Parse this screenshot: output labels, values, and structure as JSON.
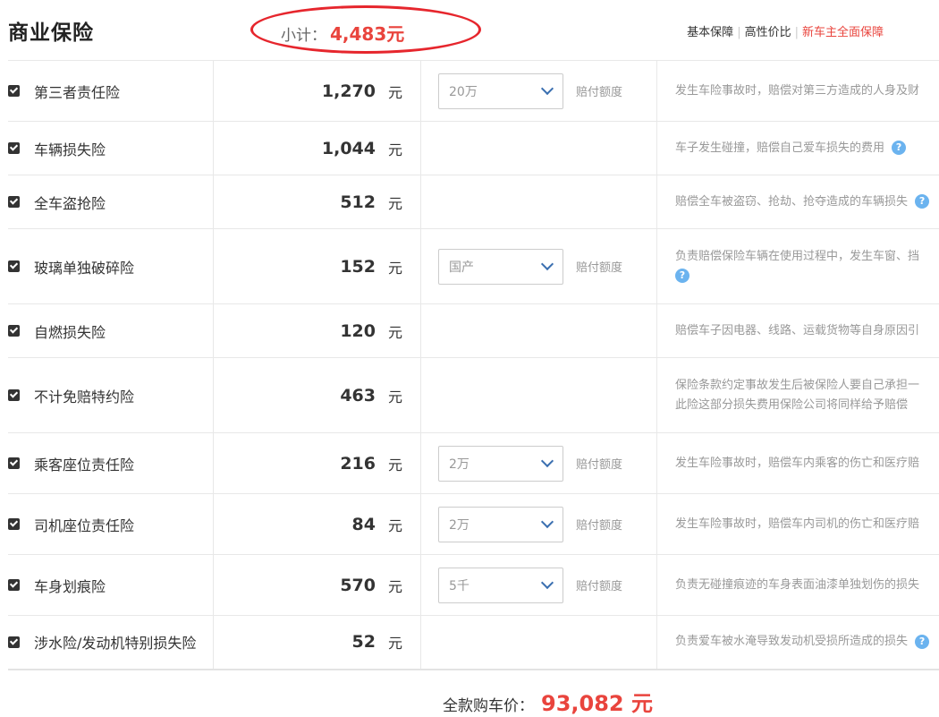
{
  "header": {
    "title": "商业保险",
    "subtotal_label": "小计：",
    "subtotal_value": "4,483元",
    "plans": [
      "基本保障",
      "高性价比",
      "新车主全面保障"
    ]
  },
  "unit": "元",
  "coverage_label": "赔付额度",
  "help_glyph": "?",
  "rows": [
    {
      "name": "第三者责任险",
      "price": "1,270",
      "select": "20万",
      "desc": "发生车险事故时，赔偿对第三方造成的人身及财",
      "desc2": ""
    },
    {
      "name": "车辆损失险",
      "price": "1,044",
      "select": "",
      "desc": "车子发生碰撞，赔偿自己爱车损失的费用",
      "desc2": ""
    },
    {
      "name": "全车盗抢险",
      "price": "512",
      "select": "",
      "desc": "赔偿全车被盗窃、抢劫、抢夺造成的车辆损失",
      "desc2": ""
    },
    {
      "name": "玻璃单独破碎险",
      "price": "152",
      "select": "国产",
      "desc": "负责赔偿保险车辆在使用过程中，发生车窗、挡",
      "desc2": ""
    },
    {
      "name": "自燃损失险",
      "price": "120",
      "select": "",
      "desc": "赔偿车子因电器、线路、运载货物等自身原因引",
      "desc2": ""
    },
    {
      "name": "不计免赔特约险",
      "price": "463",
      "select": "",
      "desc": "保险条款约定事故发生后被保险人要自己承担一",
      "desc2": "此险这部分损失费用保险公司将同样给予赔偿"
    },
    {
      "name": "乘客座位责任险",
      "price": "216",
      "select": "2万",
      "desc": "发生车险事故时，赔偿车内乘客的伤亡和医疗赔",
      "desc2": ""
    },
    {
      "name": "司机座位责任险",
      "price": "84",
      "select": "2万",
      "desc": "发生车险事故时，赔偿车内司机的伤亡和医疗赔",
      "desc2": ""
    },
    {
      "name": "车身划痕险",
      "price": "570",
      "select": "5千",
      "desc": "负责无碰撞痕迹的车身表面油漆单独划伤的损失",
      "desc2": ""
    },
    {
      "name": "涉水险/发动机特别损失险",
      "price": "52",
      "select": "",
      "desc": "负责爱车被水淹导致发动机受损所造成的损失",
      "desc2": ""
    }
  ],
  "footer": {
    "total_label": "全款购车价：",
    "total_value": "93,082 元"
  },
  "colors": {
    "accent_red": "#e9443d",
    "highlight_ellipse": "#e6262d",
    "help_blue": "#6bb3ef",
    "chevron_blue": "#3a6fb0"
  }
}
